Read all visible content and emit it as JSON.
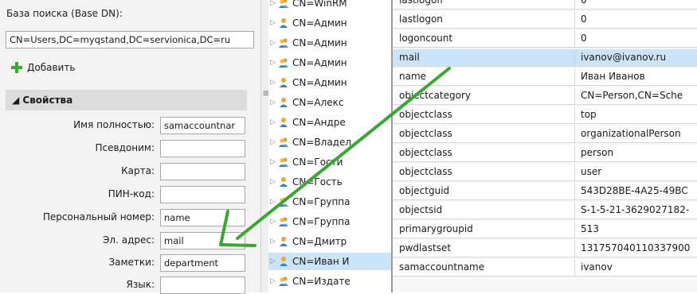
{
  "left_panel": {
    "base_dn_label": "База поиска (Base DN):",
    "base_dn_value": "CN=Users,DC=myqstand,DC=servionica,DC=ru",
    "add_label": "Добавить",
    "properties_header": "◢ Свойства",
    "fields": [
      {
        "label": "Имя полностью:",
        "value": "samaccountnar"
      },
      {
        "label": "Псевдоним:",
        "value": ""
      },
      {
        "label": "Карта:",
        "value": ""
      },
      {
        "label": "ПИН-код:",
        "value": ""
      },
      {
        "label": "Персональный номер:",
        "value": "name"
      },
      {
        "label": "Эл. адрес:",
        "value": "mail"
      },
      {
        "label": "Заметки:",
        "value": "department"
      },
      {
        "label": "Язык:",
        "value": ""
      }
    ]
  },
  "splitter": {
    "grip": "≡"
  },
  "tree": {
    "items": [
      {
        "label": "CN=WinRM",
        "icon": "users-group-icon",
        "selected": false
      },
      {
        "label": "CN=Админ",
        "icon": "user-icon",
        "selected": false
      },
      {
        "label": "CN=Админ",
        "icon": "users-group-icon",
        "selected": false
      },
      {
        "label": "CN=Админ",
        "icon": "users-group-icon",
        "selected": false
      },
      {
        "label": "CN=Админ",
        "icon": "user-icon",
        "selected": false
      },
      {
        "label": "CN=Алекс",
        "icon": "user-icon",
        "selected": false
      },
      {
        "label": "CN=Андре",
        "icon": "user-icon",
        "selected": false
      },
      {
        "label": "CN=Владел",
        "icon": "users-group-icon",
        "selected": false
      },
      {
        "label": "CN=Гости",
        "icon": "users-group-icon",
        "selected": false
      },
      {
        "label": "CN=Гость",
        "icon": "user-icon",
        "selected": false
      },
      {
        "label": "CN=Группа",
        "icon": "users-group-icon",
        "selected": false
      },
      {
        "label": "CN=Группа",
        "icon": "users-group-icon",
        "selected": false
      },
      {
        "label": "CN=Дмитр",
        "icon": "user-icon",
        "selected": false
      },
      {
        "label": "CN=Иван И",
        "icon": "user-icon",
        "selected": true
      },
      {
        "label": "CN=Издате",
        "icon": "users-group-icon",
        "selected": false
      }
    ]
  },
  "attributes": {
    "rows": [
      {
        "name": "lastlogoff",
        "value": "0"
      },
      {
        "name": "lastlogon",
        "value": "0"
      },
      {
        "name": "logoncount",
        "value": "0"
      },
      {
        "name": "mail",
        "value": "ivanov@ivanov.ru",
        "selected": true
      },
      {
        "name": "name",
        "value": "Иван Иванов"
      },
      {
        "name": "objectcategory",
        "value": "CN=Person,CN=Sche"
      },
      {
        "name": "objectclass",
        "value": "top"
      },
      {
        "name": "objectclass",
        "value": "organizationalPerson"
      },
      {
        "name": "objectclass",
        "value": "person"
      },
      {
        "name": "objectclass",
        "value": "user"
      },
      {
        "name": "objectguid",
        "value": "543D28BE-4A25-49BC"
      },
      {
        "name": "objectsid",
        "value": "S-1-5-21-3629027182-"
      },
      {
        "name": "primarygroupid",
        "value": "513"
      },
      {
        "name": "pwdlastset",
        "value": "131757040110337900"
      },
      {
        "name": "samaccountname",
        "value": "ivanov"
      }
    ]
  },
  "colors": {
    "selection": "#cce4f7",
    "arrow": "#3aa636",
    "add_icon": "#3aa636"
  }
}
